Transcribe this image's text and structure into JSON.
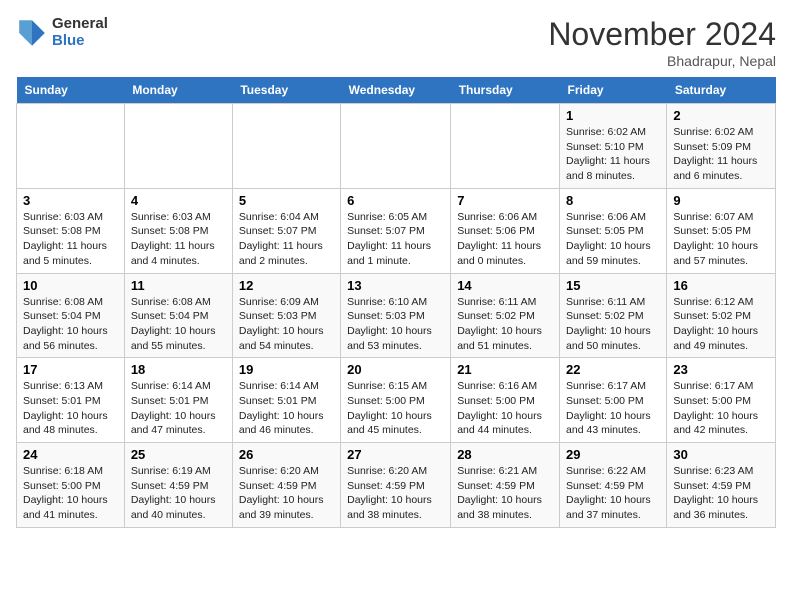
{
  "header": {
    "logo_general": "General",
    "logo_blue": "Blue",
    "month_title": "November 2024",
    "location": "Bhadrapur, Nepal"
  },
  "weekdays": [
    "Sunday",
    "Monday",
    "Tuesday",
    "Wednesday",
    "Thursday",
    "Friday",
    "Saturday"
  ],
  "weeks": [
    [
      {
        "day": "",
        "info": ""
      },
      {
        "day": "",
        "info": ""
      },
      {
        "day": "",
        "info": ""
      },
      {
        "day": "",
        "info": ""
      },
      {
        "day": "",
        "info": ""
      },
      {
        "day": "1",
        "info": "Sunrise: 6:02 AM\nSunset: 5:10 PM\nDaylight: 11 hours\nand 8 minutes."
      },
      {
        "day": "2",
        "info": "Sunrise: 6:02 AM\nSunset: 5:09 PM\nDaylight: 11 hours\nand 6 minutes."
      }
    ],
    [
      {
        "day": "3",
        "info": "Sunrise: 6:03 AM\nSunset: 5:08 PM\nDaylight: 11 hours\nand 5 minutes."
      },
      {
        "day": "4",
        "info": "Sunrise: 6:03 AM\nSunset: 5:08 PM\nDaylight: 11 hours\nand 4 minutes."
      },
      {
        "day": "5",
        "info": "Sunrise: 6:04 AM\nSunset: 5:07 PM\nDaylight: 11 hours\nand 2 minutes."
      },
      {
        "day": "6",
        "info": "Sunrise: 6:05 AM\nSunset: 5:07 PM\nDaylight: 11 hours\nand 1 minute."
      },
      {
        "day": "7",
        "info": "Sunrise: 6:06 AM\nSunset: 5:06 PM\nDaylight: 11 hours\nand 0 minutes."
      },
      {
        "day": "8",
        "info": "Sunrise: 6:06 AM\nSunset: 5:05 PM\nDaylight: 10 hours\nand 59 minutes."
      },
      {
        "day": "9",
        "info": "Sunrise: 6:07 AM\nSunset: 5:05 PM\nDaylight: 10 hours\nand 57 minutes."
      }
    ],
    [
      {
        "day": "10",
        "info": "Sunrise: 6:08 AM\nSunset: 5:04 PM\nDaylight: 10 hours\nand 56 minutes."
      },
      {
        "day": "11",
        "info": "Sunrise: 6:08 AM\nSunset: 5:04 PM\nDaylight: 10 hours\nand 55 minutes."
      },
      {
        "day": "12",
        "info": "Sunrise: 6:09 AM\nSunset: 5:03 PM\nDaylight: 10 hours\nand 54 minutes."
      },
      {
        "day": "13",
        "info": "Sunrise: 6:10 AM\nSunset: 5:03 PM\nDaylight: 10 hours\nand 53 minutes."
      },
      {
        "day": "14",
        "info": "Sunrise: 6:11 AM\nSunset: 5:02 PM\nDaylight: 10 hours\nand 51 minutes."
      },
      {
        "day": "15",
        "info": "Sunrise: 6:11 AM\nSunset: 5:02 PM\nDaylight: 10 hours\nand 50 minutes."
      },
      {
        "day": "16",
        "info": "Sunrise: 6:12 AM\nSunset: 5:02 PM\nDaylight: 10 hours\nand 49 minutes."
      }
    ],
    [
      {
        "day": "17",
        "info": "Sunrise: 6:13 AM\nSunset: 5:01 PM\nDaylight: 10 hours\nand 48 minutes."
      },
      {
        "day": "18",
        "info": "Sunrise: 6:14 AM\nSunset: 5:01 PM\nDaylight: 10 hours\nand 47 minutes."
      },
      {
        "day": "19",
        "info": "Sunrise: 6:14 AM\nSunset: 5:01 PM\nDaylight: 10 hours\nand 46 minutes."
      },
      {
        "day": "20",
        "info": "Sunrise: 6:15 AM\nSunset: 5:00 PM\nDaylight: 10 hours\nand 45 minutes."
      },
      {
        "day": "21",
        "info": "Sunrise: 6:16 AM\nSunset: 5:00 PM\nDaylight: 10 hours\nand 44 minutes."
      },
      {
        "day": "22",
        "info": "Sunrise: 6:17 AM\nSunset: 5:00 PM\nDaylight: 10 hours\nand 43 minutes."
      },
      {
        "day": "23",
        "info": "Sunrise: 6:17 AM\nSunset: 5:00 PM\nDaylight: 10 hours\nand 42 minutes."
      }
    ],
    [
      {
        "day": "24",
        "info": "Sunrise: 6:18 AM\nSunset: 5:00 PM\nDaylight: 10 hours\nand 41 minutes."
      },
      {
        "day": "25",
        "info": "Sunrise: 6:19 AM\nSunset: 4:59 PM\nDaylight: 10 hours\nand 40 minutes."
      },
      {
        "day": "26",
        "info": "Sunrise: 6:20 AM\nSunset: 4:59 PM\nDaylight: 10 hours\nand 39 minutes."
      },
      {
        "day": "27",
        "info": "Sunrise: 6:20 AM\nSunset: 4:59 PM\nDaylight: 10 hours\nand 38 minutes."
      },
      {
        "day": "28",
        "info": "Sunrise: 6:21 AM\nSunset: 4:59 PM\nDaylight: 10 hours\nand 38 minutes."
      },
      {
        "day": "29",
        "info": "Sunrise: 6:22 AM\nSunset: 4:59 PM\nDaylight: 10 hours\nand 37 minutes."
      },
      {
        "day": "30",
        "info": "Sunrise: 6:23 AM\nSunset: 4:59 PM\nDaylight: 10 hours\nand 36 minutes."
      }
    ]
  ]
}
